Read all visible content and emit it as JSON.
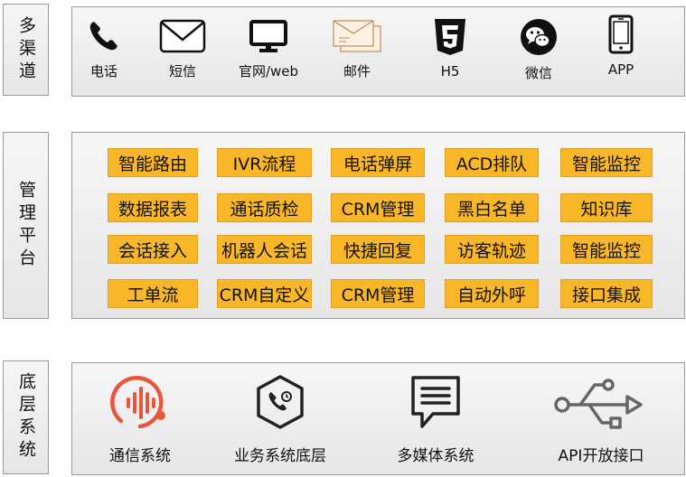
{
  "sections": {
    "channels": {
      "title": "多渠道",
      "items": [
        {
          "label": "电话",
          "icon": "phone-icon"
        },
        {
          "label": "短信",
          "icon": "envelope-icon"
        },
        {
          "label": "官网/web",
          "icon": "monitor-icon"
        },
        {
          "label": "邮件",
          "icon": "mail-icon"
        },
        {
          "label": "H5",
          "icon": "html5-icon"
        },
        {
          "label": "微信",
          "icon": "wechat-icon"
        },
        {
          "label": "APP",
          "icon": "smartphone-icon"
        }
      ]
    },
    "platform": {
      "title": "管理平台",
      "rows": [
        [
          "智能路由",
          "IVR流程",
          "电话弹屏",
          "ACD排队",
          "智能监控"
        ],
        [
          "数据报表",
          "通话质检",
          "CRM管理",
          "黑白名单",
          "知识库"
        ],
        [
          "会话接入",
          "机器人会话",
          "快捷回复",
          "访客轨迹",
          "智能监控"
        ],
        [
          "工单流",
          "CRM自定义",
          "CRM管理",
          "自动外呼",
          "接口集成"
        ]
      ]
    },
    "base": {
      "title": "底层系统",
      "items": [
        {
          "label": "通信系统",
          "icon": "voice-wave-icon"
        },
        {
          "label": "业务系统底层",
          "icon": "hexagon-phone-icon"
        },
        {
          "label": "多媒体系统",
          "icon": "chat-bubble-icon"
        },
        {
          "label": "API开放接口",
          "icon": "usb-icon"
        }
      ]
    }
  },
  "colors": {
    "tag_fill": "#f8b728",
    "accent_red": "#e8553a",
    "icon_dark": "#222222"
  }
}
